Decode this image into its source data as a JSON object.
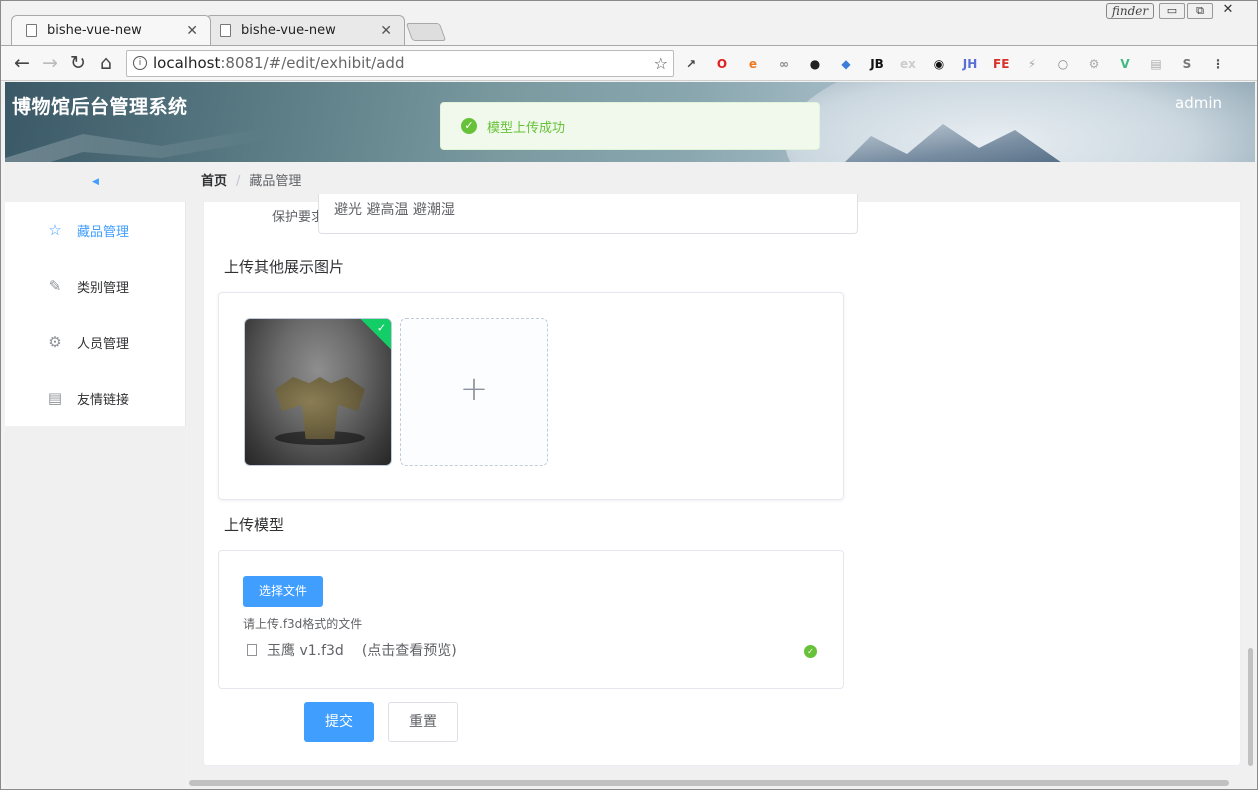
{
  "browser": {
    "tabs": [
      {
        "label": "bishe-vue-new",
        "close": "✕"
      },
      {
        "label": "bishe-vue-new",
        "close": "✕"
      }
    ],
    "finder_label": "finder",
    "window_controls": {
      "minimize": "▭",
      "restore": "⧉",
      "close": "✕"
    },
    "nav": {
      "back": "←",
      "forward": "→",
      "reload": "↻",
      "home": "⌂"
    },
    "address": {
      "host": "localhost",
      "path": ":8081/#/edit/exhibit/add"
    },
    "star": "☆",
    "extensions": [
      {
        "name": "extension-icon-1",
        "text": "↗",
        "color": "#444444"
      },
      {
        "name": "opera-icon",
        "text": "O",
        "color": "#e02020"
      },
      {
        "name": "extension-icon-3",
        "text": "e",
        "color": "#f07a20"
      },
      {
        "name": "extension-icon-4",
        "text": "∞",
        "color": "#888888"
      },
      {
        "name": "extension-icon-5",
        "text": "●",
        "color": "#222222"
      },
      {
        "name": "extension-icon-6",
        "text": "◆",
        "color": "#3b7dd8"
      },
      {
        "name": "jb-icon",
        "text": "JB",
        "color": "#111111"
      },
      {
        "name": "ex-icon",
        "text": "ex",
        "color": "#cccccc"
      },
      {
        "name": "eye-icon",
        "text": "◉",
        "color": "#111111"
      },
      {
        "name": "jh-icon",
        "text": "JH",
        "color": "#5a6fd6"
      },
      {
        "name": "fe-icon",
        "text": "FE",
        "color": "#d8302a"
      },
      {
        "name": "extension-icon-12",
        "text": "⚡",
        "color": "#aaaaaa"
      },
      {
        "name": "extension-icon-13",
        "text": "○",
        "color": "#888888"
      },
      {
        "name": "extension-icon-14",
        "text": "⚙",
        "color": "#aaaaaa"
      },
      {
        "name": "vue-devtools-icon",
        "text": "V",
        "color": "#41b883"
      },
      {
        "name": "extension-icon-16",
        "text": "▤",
        "color": "#aaaaaa"
      },
      {
        "name": "extension-icon-17",
        "text": "S",
        "color": "#777777"
      },
      {
        "name": "menu-icon",
        "text": "⋮",
        "color": "#555555"
      }
    ]
  },
  "app": {
    "title": "博物馆后台管理系统",
    "user": "admin",
    "toast": "模型上传成功",
    "collapse_icon": "◀",
    "breadcrumb": {
      "home": "首页",
      "separator": "/",
      "current": "藏品管理"
    }
  },
  "sidebar": {
    "items": [
      {
        "label": "藏品管理",
        "icon": "☆"
      },
      {
        "label": "类别管理",
        "icon": "✎"
      },
      {
        "label": "人员管理",
        "icon": "⚙"
      },
      {
        "label": "友情链接",
        "icon": "▤"
      }
    ]
  },
  "form": {
    "protect_label": "保护要求",
    "protect_value": "避光 避高温 避潮湿",
    "images_title": "上传其他展示图片",
    "add_symbol": "+",
    "model_title": "上传模型",
    "choose_file": "选择文件",
    "tip": "请上传.f3d格式的文件",
    "file_name": "玉鹰 v1.f3d",
    "file_preview": "(点击查看预览)",
    "submit": "提交",
    "reset": "重置"
  },
  "colors": {
    "primary": "#409eff",
    "success": "#67c23a",
    "upload_badge": "#13ce66"
  }
}
